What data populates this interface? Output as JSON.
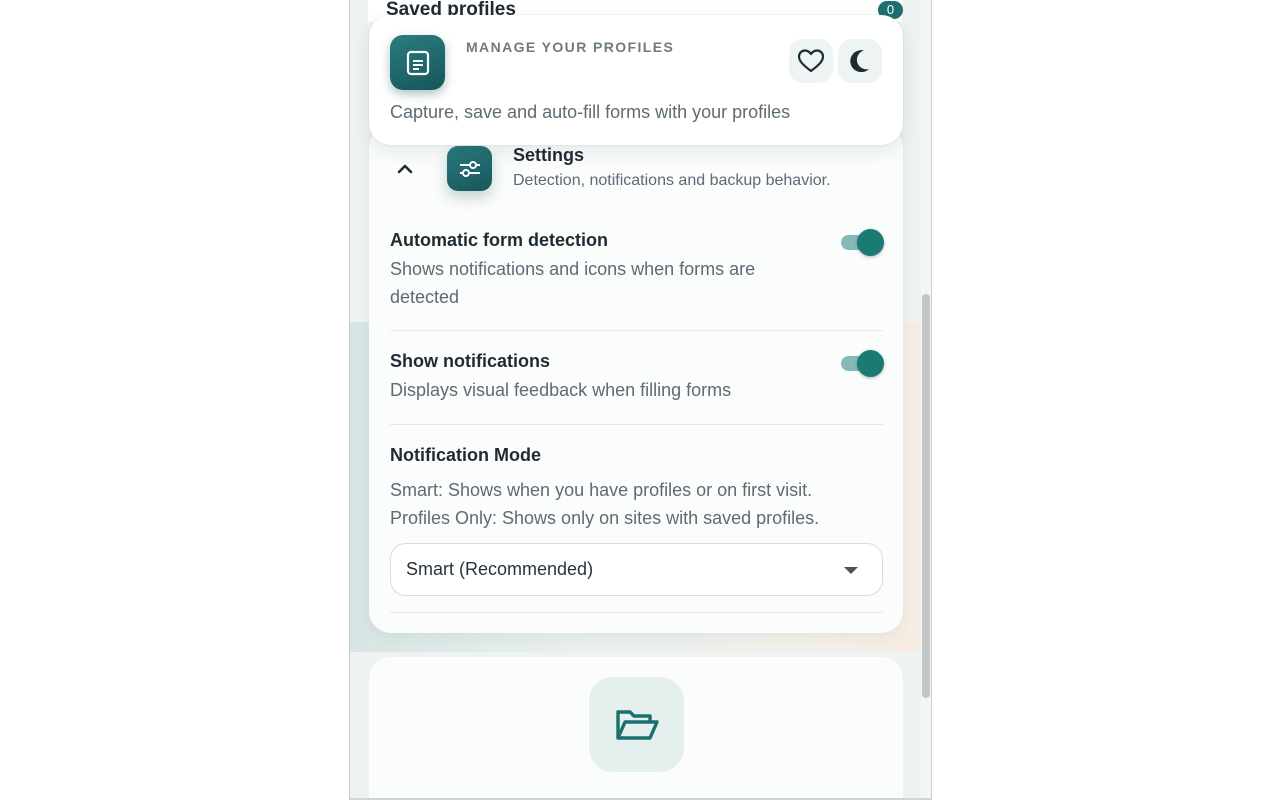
{
  "saved_profiles": {
    "title": "Saved profiles",
    "count": "0"
  },
  "header": {
    "eyebrow": "MANAGE YOUR PROFILES",
    "title": "",
    "subtitle": "Capture, save and auto-fill forms with your profiles",
    "favorite_icon": "heart-icon",
    "theme_icon": "moon-icon"
  },
  "settings": {
    "title": "Settings",
    "subtitle": "Detection, notifications and backup behavior.",
    "auto_detect": {
      "title": "Automatic form detection",
      "desc": "Shows notifications and icons when forms are detected",
      "enabled": true
    },
    "notifications": {
      "title": "Show notifications",
      "desc": "Displays visual feedback when filling forms",
      "enabled": true
    },
    "mode": {
      "title": "Notification Mode",
      "desc_1": "Smart: Shows when you have profiles or on first visit.",
      "desc_2": "Profiles Only: Shows only on sites with saved profiles.",
      "selected": "Smart (Recommended)"
    }
  },
  "colors": {
    "accent": "#1e6f72",
    "toggle_on": "#1b7a74"
  }
}
